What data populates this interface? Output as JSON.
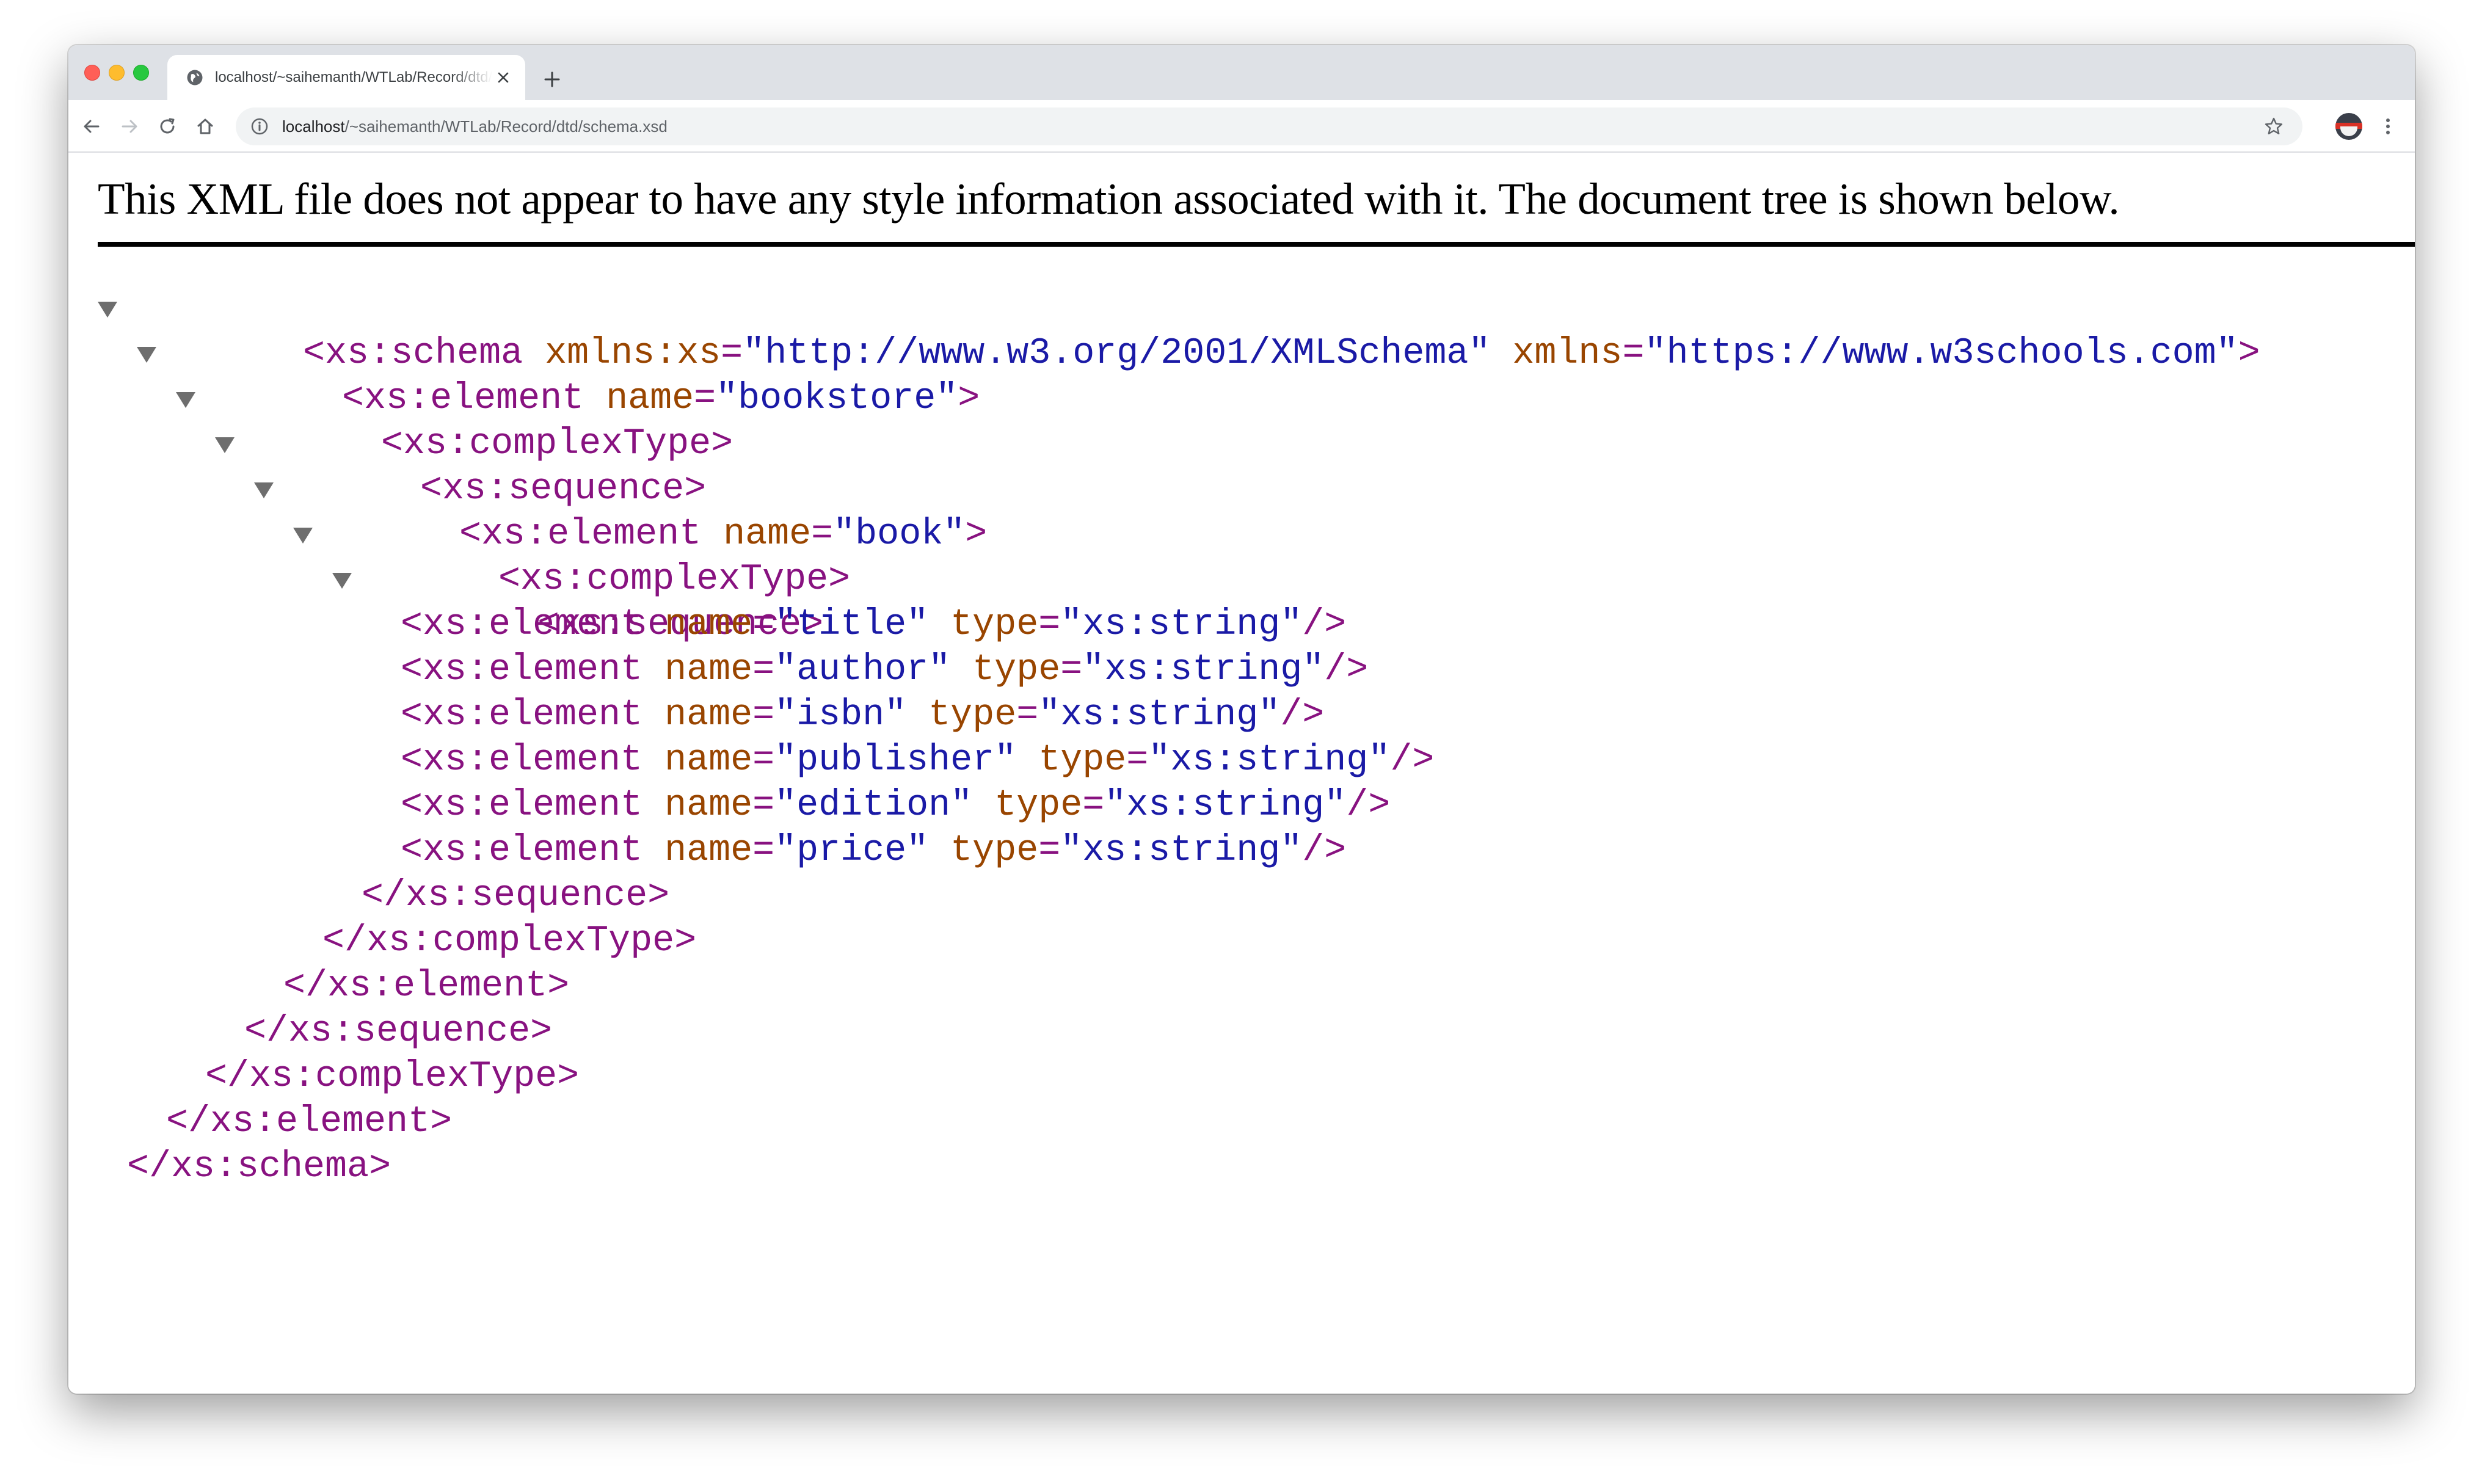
{
  "browser": {
    "tab_title": "localhost/~saihemanth/WTLab/Record/dtd/schema.xsd",
    "url_host": "localhost",
    "url_path": "/~saihemanth/WTLab/Record/dtd/schema.xsd"
  },
  "page": {
    "header_message": "This XML file does not appear to have any style information associated with it. The document tree is shown below."
  },
  "xml": {
    "l1": {
      "open": "<xs:schema",
      "attr1": " xmlns:xs",
      "eq1": "=",
      "val1": "\"http://www.w3.org/2001/XMLSchema\"",
      "attr2": " xmlns",
      "eq2": "=",
      "val2": "\"https://www.w3schools.com\"",
      "close": ">"
    },
    "l2": {
      "open": "<xs:element",
      "attr1": " name",
      "eq1": "=",
      "val1": "\"bookstore\"",
      "close": ">"
    },
    "l3": {
      "tag": "<xs:complexType>"
    },
    "l4": {
      "tag": "<xs:sequence>"
    },
    "l5": {
      "open": "<xs:element",
      "attr1": " name",
      "eq1": "=",
      "val1": "\"book\"",
      "close": ">"
    },
    "l6": {
      "tag": "<xs:complexType>"
    },
    "l7": {
      "tag": "<xs:sequence>"
    },
    "elements": [
      {
        "open": "<xs:element",
        "a1": " name",
        "e1": "=",
        "v1": "\"title\"",
        "a2": " type",
        "e2": "=",
        "v2": "\"xs:string\"",
        "close": "/>"
      },
      {
        "open": "<xs:element",
        "a1": " name",
        "e1": "=",
        "v1": "\"author\"",
        "a2": " type",
        "e2": "=",
        "v2": "\"xs:string\"",
        "close": "/>"
      },
      {
        "open": "<xs:element",
        "a1": " name",
        "e1": "=",
        "v1": "\"isbn\"",
        "a2": " type",
        "e2": "=",
        "v2": "\"xs:string\"",
        "close": "/>"
      },
      {
        "open": "<xs:element",
        "a1": " name",
        "e1": "=",
        "v1": "\"publisher\"",
        "a2": " type",
        "e2": "=",
        "v2": "\"xs:string\"",
        "close": "/>"
      },
      {
        "open": "<xs:element",
        "a1": " name",
        "e1": "=",
        "v1": "\"edition\"",
        "a2": " type",
        "e2": "=",
        "v2": "\"xs:string\"",
        "close": "/>"
      },
      {
        "open": "<xs:element",
        "a1": " name",
        "e1": "=",
        "v1": "\"price\"",
        "a2": " type",
        "e2": "=",
        "v2": "\"xs:string\"",
        "close": "/>"
      }
    ],
    "c7": "</xs:sequence>",
    "c6": "</xs:complexType>",
    "c5": "</xs:element>",
    "c4": "</xs:sequence>",
    "c3": "</xs:complexType>",
    "c2": "</xs:element>",
    "c1": "</xs:schema>"
  },
  "colors": {
    "tag": "#881280",
    "attribute": "#994500",
    "value": "#1a1aa6",
    "tabstrip": "#dee1e6"
  }
}
